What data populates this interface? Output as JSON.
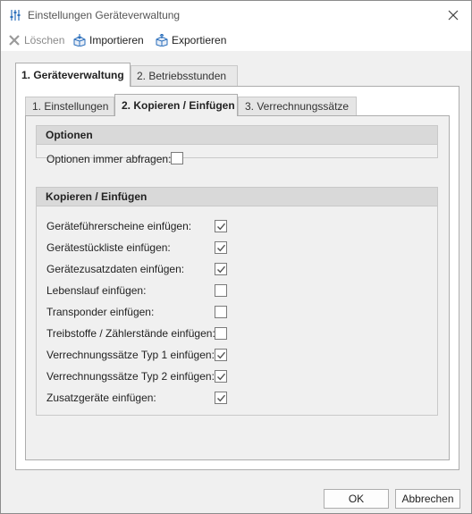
{
  "window": {
    "title": "Einstellungen Geräteverwaltung"
  },
  "toolbar": {
    "delete_label": "Löschen",
    "import_label": "Importieren",
    "export_label": "Exportieren"
  },
  "outer_tabs": [
    {
      "label": "1. Geräteverwaltung",
      "active": true
    },
    {
      "label": "2. Betriebsstunden",
      "active": false
    }
  ],
  "inner_tabs": [
    {
      "label": "1. Einstellungen",
      "active": false
    },
    {
      "label": "2. Kopieren / Einfügen",
      "active": true
    },
    {
      "label": "3. Verrechnungssätze",
      "active": false
    }
  ],
  "options_group": {
    "title": "Optionen",
    "items": [
      {
        "label": "Optionen immer abfragen:",
        "checked": false
      }
    ]
  },
  "copy_group": {
    "title": "Kopieren / Einfügen",
    "items": [
      {
        "label": "Geräteführerscheine einfügen:",
        "checked": true
      },
      {
        "label": "Gerätestückliste einfügen:",
        "checked": true
      },
      {
        "label": "Gerätezusatzdaten einfügen:",
        "checked": true
      },
      {
        "label": "Lebenslauf einfügen:",
        "checked": false
      },
      {
        "label": "Transponder einfügen:",
        "checked": false
      },
      {
        "label": "Treibstoffe / Zählerstände einfügen:",
        "checked": false
      },
      {
        "label": "Verrechnungssätze Typ 1 einfügen:",
        "checked": true
      },
      {
        "label": "Verrechnungssätze Typ 2 einfügen:",
        "checked": true
      },
      {
        "label": "Zusatzgeräte einfügen:",
        "checked": true
      }
    ]
  },
  "buttons": {
    "ok": "OK",
    "cancel": "Abbrechen"
  },
  "icons": {
    "title": "settings-sliders-icon",
    "delete": "delete-x-icon",
    "import": "import-box-icon",
    "export": "export-box-icon",
    "close": "close-icon"
  },
  "colors": {
    "icon_blue": "#2a6ebb",
    "disabled_gray": "#9a9a9a",
    "check": "#555555"
  }
}
